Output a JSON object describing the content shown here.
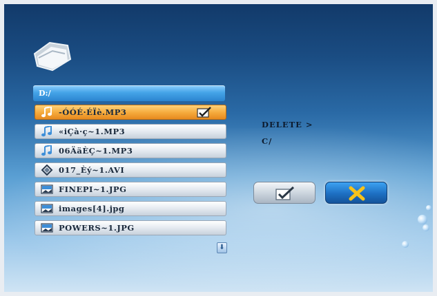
{
  "browser": {
    "path": "D:/",
    "files": [
      {
        "name": "-ÓÓÉ·ÉÏè.MP3",
        "type": "music-icon",
        "selected": true
      },
      {
        "name": "«iÇà·ç~1.MP3",
        "type": "music-icon",
        "selected": false
      },
      {
        "name": "06ÄäÈÇ~1.MP3",
        "type": "music-icon",
        "selected": false
      },
      {
        "name": "017_Èý~1.AVI",
        "type": "video-icon",
        "selected": false
      },
      {
        "name": "FINEPI~1.JPG",
        "type": "image-icon",
        "selected": false
      },
      {
        "name": "images[4].jpg",
        "type": "image-icon",
        "selected": false
      },
      {
        "name": "POWERS~1.JPG",
        "type": "image-icon",
        "selected": false
      }
    ],
    "scroll_down_glyph": "⬇"
  },
  "dialog": {
    "title": "DELETE >",
    "path": "C/",
    "confirm_icon": "check-icon",
    "cancel_icon": "x-icon"
  },
  "colors": {
    "selected_row": "#f5a93a",
    "path_bar": "#45a4e8",
    "cancel_button": "#1d6fc2",
    "cancel_x": "#f7c21a"
  }
}
